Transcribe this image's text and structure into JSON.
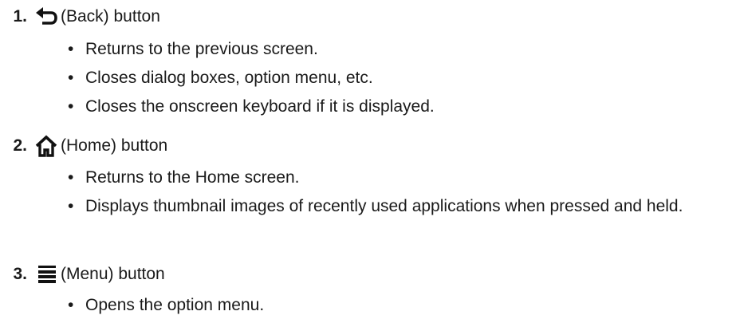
{
  "items": [
    {
      "number": "1.",
      "icon": "back-arrow-icon",
      "label": "(Back) button",
      "bullets": [
        "Returns to the previous screen.",
        "Closes dialog boxes, option menu, etc.",
        "Closes the onscreen keyboard if it is displayed."
      ]
    },
    {
      "number": "2.",
      "icon": "home-icon",
      "label": "(Home) button",
      "bullets": [
        "Returns to the Home screen.",
        "Displays thumbnail images of recently used applications when pressed and held."
      ]
    },
    {
      "number": "3.",
      "icon": "menu-icon",
      "label": "(Menu) button",
      "bullets": [
        "Opens the option menu."
      ]
    }
  ],
  "bullet_glyph": "•"
}
